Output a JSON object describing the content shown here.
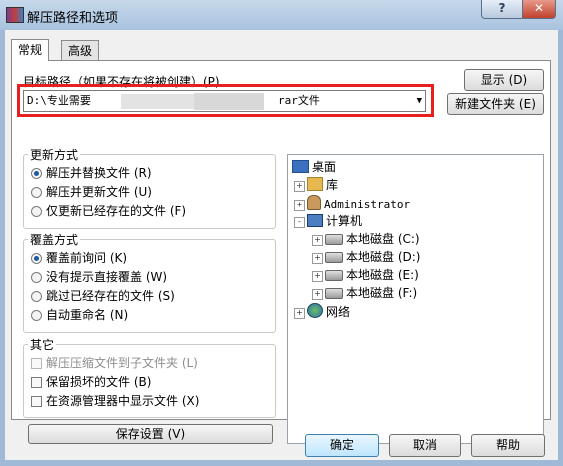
{
  "window": {
    "title": "解压路径和选项",
    "help_glyph": "?",
    "close_glyph": "✕"
  },
  "tabs": [
    {
      "label": "常规"
    },
    {
      "label": "高级"
    }
  ],
  "target": {
    "label": "目标路径（如果不存在将被创建）(P)",
    "path_prefix": "D:\\专业需要",
    "path_suffix": "rar文件",
    "show_button": "显示 (D)",
    "new_folder_button": "新建文件夹 (E)"
  },
  "update_mode": {
    "title": "更新方式",
    "options": [
      {
        "label": "解压并替换文件 (R)",
        "selected": true
      },
      {
        "label": "解压并更新文件 (U)",
        "selected": false
      },
      {
        "label": "仅更新已经存在的文件 (F)",
        "selected": false
      }
    ]
  },
  "overwrite_mode": {
    "title": "覆盖方式",
    "options": [
      {
        "label": "覆盖前询问 (K)",
        "selected": true
      },
      {
        "label": "没有提示直接覆盖 (W)",
        "selected": false
      },
      {
        "label": "跳过已经存在的文件 (S)",
        "selected": false
      },
      {
        "label": "自动重命名 (N)",
        "selected": false
      }
    ]
  },
  "misc": {
    "title": "其它",
    "options": [
      {
        "label": "解压压缩文件到子文件夹 (L)",
        "checked": false,
        "disabled": true
      },
      {
        "label": "保留损坏的文件 (B)",
        "checked": false,
        "disabled": false
      },
      {
        "label": "在资源管理器中显示文件 (X)",
        "checked": false,
        "disabled": false
      }
    ]
  },
  "save_settings_button": "保存设置 (V)",
  "tree": {
    "desktop": "桌面",
    "library": "库",
    "user": "Administrator",
    "computer": "计算机",
    "drives": [
      "本地磁盘 (C:)",
      "本地磁盘 (D:)",
      "本地磁盘 (E:)",
      "本地磁盘 (F:)"
    ],
    "network": "网络"
  },
  "footer": {
    "ok": "确定",
    "cancel": "取消",
    "help": "帮助"
  },
  "icons": {
    "app": "winrar-books-icon",
    "expand": "+",
    "collapse": "-",
    "dropdown": "▼"
  },
  "colors": {
    "highlight_box": "#e81f1f",
    "titlebar": "#a9c3df"
  }
}
